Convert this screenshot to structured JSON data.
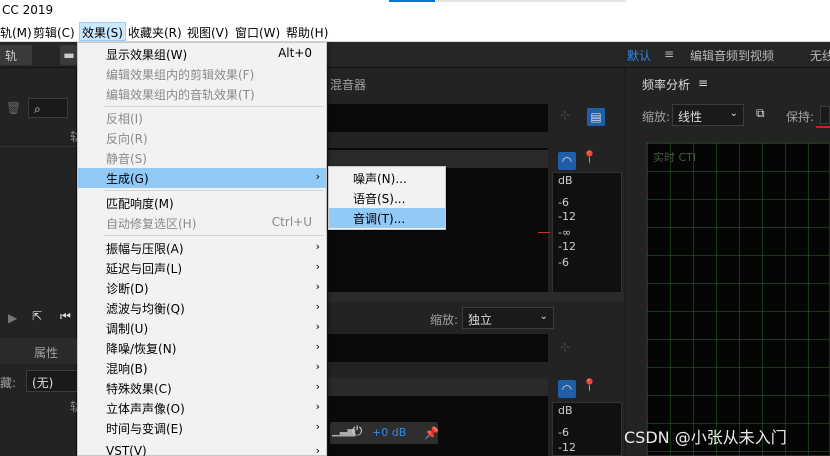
{
  "app": {
    "title_fragment": "CC 2019"
  },
  "menubar": {
    "items": [
      "轨(M)",
      "剪辑(C)",
      "效果(S)",
      "收藏夹(R)",
      "视图(V)",
      "窗口(W)",
      "帮助(H)"
    ],
    "active": "效果(S)"
  },
  "toolbar": {
    "left_btn": "轨",
    "workspaces": [
      "默认",
      "编辑音频到视频",
      "无线"
    ],
    "active_workspace": "默认"
  },
  "left_panel": {
    "tab_properties": "属性",
    "label_zang": "藏:",
    "value_none": "(无)",
    "fragment_gui": "轨"
  },
  "mid_panel": {
    "header": "混音器",
    "meter_labels_top": [
      "dB",
      "-6",
      "-12",
      "-∞",
      "-12",
      "-6"
    ],
    "zoom_label": "缩放:",
    "zoom_value": "独立",
    "meter_labels_bottom": [
      "dB",
      "-6",
      "-12"
    ],
    "db_value": "+0 dB"
  },
  "right_panel": {
    "title": "频率分析",
    "zoom_label": "缩放:",
    "zoom_value": "线性",
    "keep_label": "保持:",
    "graph_label": "实时 CTI"
  },
  "effects_menu": {
    "items": [
      {
        "label": "显示效果组(W)",
        "shortcut": "Alt+0",
        "disabled": false
      },
      {
        "label": "编辑效果组内的剪辑效果(F)",
        "disabled": true
      },
      {
        "label": "编辑效果组内的音轨效果(T)",
        "disabled": true
      },
      {
        "label": "反相(I)",
        "disabled": true
      },
      {
        "label": "反向(R)",
        "disabled": true
      },
      {
        "label": "静音(S)",
        "disabled": true
      },
      {
        "label": "生成(G)",
        "submenu": true,
        "highlighted": true
      },
      {
        "label": "匹配响度(M)",
        "disabled": false
      },
      {
        "label": "自动修复选区(H)",
        "shortcut": "Ctrl+U",
        "disabled": true
      },
      {
        "label": "振幅与压限(A)",
        "submenu": true
      },
      {
        "label": "延迟与回声(L)",
        "submenu": true
      },
      {
        "label": "诊断(D)",
        "submenu": true
      },
      {
        "label": "滤波与均衡(Q)",
        "submenu": true
      },
      {
        "label": "调制(U)",
        "submenu": true
      },
      {
        "label": "降噪/恢复(N)",
        "submenu": true
      },
      {
        "label": "混响(B)",
        "submenu": true
      },
      {
        "label": "特殊效果(C)",
        "submenu": true
      },
      {
        "label": "立体声声像(O)",
        "submenu": true
      },
      {
        "label": "时间与变调(E)",
        "submenu": true
      },
      {
        "label": "VST(V)",
        "submenu": true
      }
    ]
  },
  "generate_submenu": {
    "items": [
      {
        "label": "噪声(N)..."
      },
      {
        "label": "语音(S)..."
      },
      {
        "label": "音调(T)...",
        "highlighted": true
      }
    ]
  },
  "watermark": "CSDN @小张从未入门",
  "colors": {
    "menu_highlight": "#91c9f7",
    "accent_blue": "#2d8ceb",
    "grid_green": "#3c963c"
  }
}
